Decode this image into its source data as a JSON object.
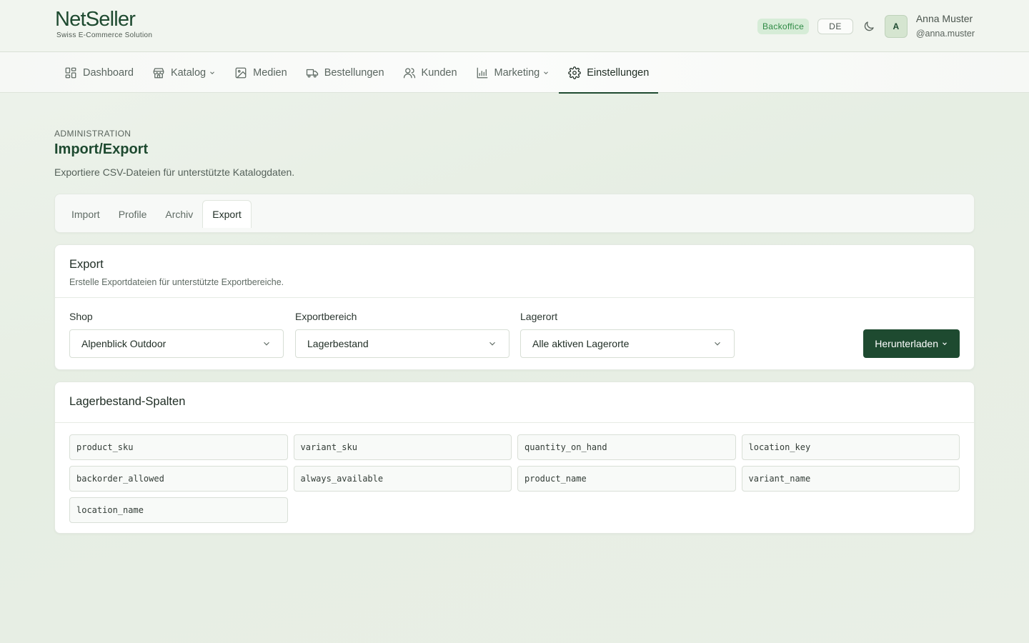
{
  "header": {
    "brand": "NetSeller",
    "tagline": "Swiss E-Commerce Solution",
    "badge": "Backoffice",
    "language": "DE",
    "avatar_initial": "A",
    "user_name": "Anna Muster",
    "user_handle": "@anna.muster"
  },
  "nav": {
    "items": [
      {
        "label": "Dashboard",
        "icon": "dashboard-icon"
      },
      {
        "label": "Katalog",
        "icon": "store-icon"
      },
      {
        "label": "Medien",
        "icon": "image-icon"
      },
      {
        "label": "Bestellungen",
        "icon": "truck-icon"
      },
      {
        "label": "Kunden",
        "icon": "users-icon"
      },
      {
        "label": "Marketing",
        "icon": "chart-icon"
      },
      {
        "label": "Einstellungen",
        "icon": "gear-icon"
      }
    ],
    "active": "Einstellungen"
  },
  "page": {
    "eyebrow": "ADMINISTRATION",
    "title": "Import/Export",
    "description": "Exportiere CSV-Dateien für unterstützte Katalogdaten."
  },
  "tabs": [
    "Import",
    "Profile",
    "Archiv",
    "Export"
  ],
  "active_tab": "Export",
  "export_card": {
    "title": "Export",
    "subtitle": "Erstelle Exportdateien für unterstützte Exportbereiche.",
    "shop_label": "Shop",
    "shop_value": "Alpenblick Outdoor",
    "area_label": "Exportbereich",
    "area_value": "Lagerbestand",
    "location_label": "Lagerort",
    "location_value": "Alle aktiven Lagerorte",
    "download_label": "Herunterladen"
  },
  "columns_card": {
    "title": "Lagerbestand-Spalten",
    "columns": [
      "product_sku",
      "variant_sku",
      "quantity_on_hand",
      "location_key",
      "backorder_allowed",
      "always_available",
      "product_name",
      "variant_name",
      "location_name"
    ]
  },
  "colors": {
    "accent": "#1e4a30",
    "badge_bg": "#d6ecd7",
    "badge_text": "#2f8a45"
  }
}
